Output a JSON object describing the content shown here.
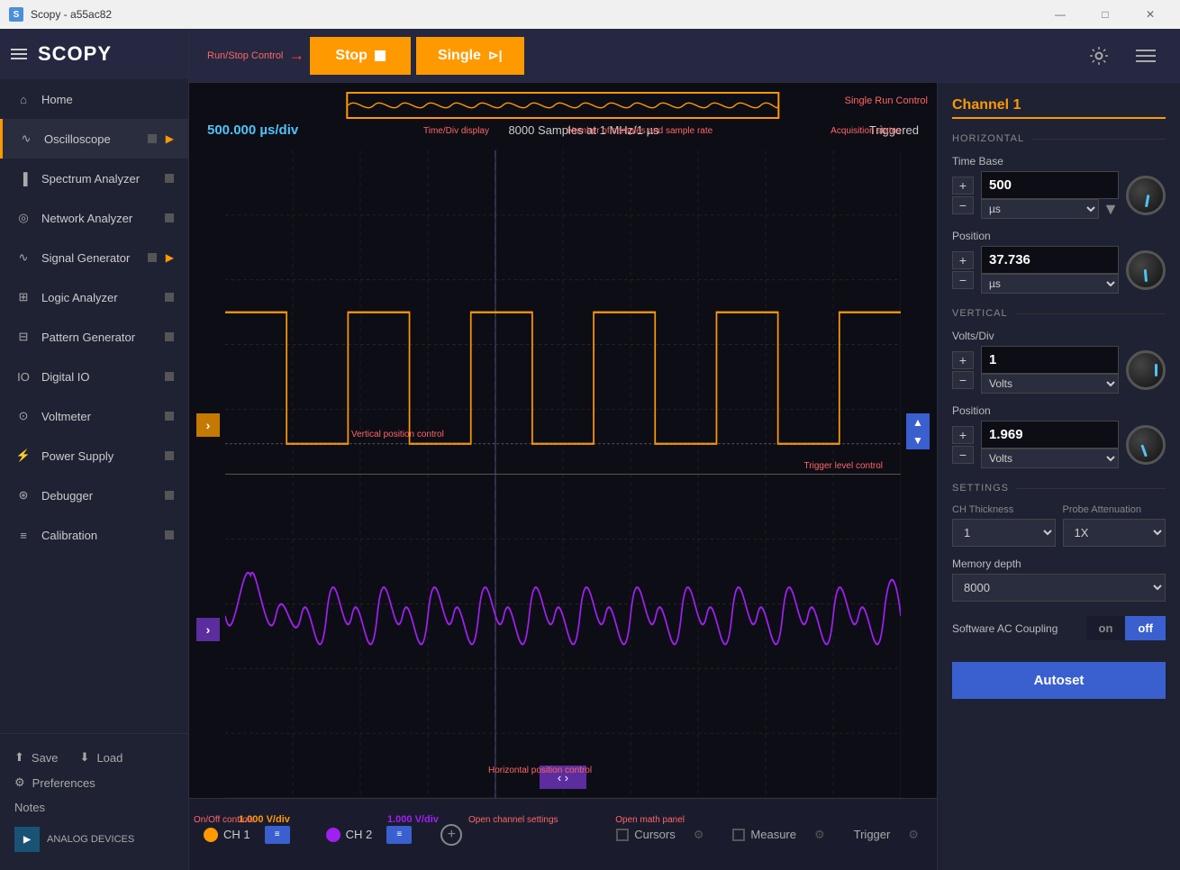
{
  "titlebar": {
    "icon": "S",
    "title": "Scopy - a55ac82",
    "min_btn": "—",
    "max_btn": "□",
    "close_btn": "✕"
  },
  "app_title": "SCOPY",
  "toolbar": {
    "run_stop_label": "Run/Stop Control",
    "stop_btn": "Stop",
    "single_btn": "Single",
    "single_run_label": "Single Run Control"
  },
  "sidebar": {
    "items": [
      {
        "id": "home",
        "label": "Home",
        "icon": "home",
        "active": false,
        "has_indicator": false,
        "has_arrow": false
      },
      {
        "id": "oscilloscope",
        "label": "Oscilloscope",
        "icon": "osc",
        "active": true,
        "has_indicator": true,
        "has_arrow": true
      },
      {
        "id": "spectrum",
        "label": "Spectrum Analyzer",
        "icon": "spectrum",
        "active": false,
        "has_indicator": true,
        "has_arrow": false
      },
      {
        "id": "network",
        "label": "Network Analyzer",
        "icon": "network",
        "active": false,
        "has_indicator": true,
        "has_arrow": false
      },
      {
        "id": "signal",
        "label": "Signal Generator",
        "icon": "signal",
        "active": false,
        "has_indicator": true,
        "has_arrow": true
      },
      {
        "id": "logic",
        "label": "Logic Analyzer",
        "icon": "logic",
        "active": false,
        "has_indicator": true,
        "has_arrow": false
      },
      {
        "id": "pattern",
        "label": "Pattern Generator",
        "icon": "pattern",
        "active": false,
        "has_indicator": true,
        "has_arrow": false
      },
      {
        "id": "digital",
        "label": "Digital IO",
        "icon": "digital",
        "active": false,
        "has_indicator": true,
        "has_arrow": false
      },
      {
        "id": "voltmeter",
        "label": "Voltmeter",
        "icon": "voltmeter",
        "active": false,
        "has_indicator": true,
        "has_arrow": false
      },
      {
        "id": "power",
        "label": "Power Supply",
        "icon": "power",
        "active": false,
        "has_indicator": true,
        "has_arrow": false
      },
      {
        "id": "debugger",
        "label": "Debugger",
        "icon": "debug",
        "active": false,
        "has_indicator": true,
        "has_arrow": false
      },
      {
        "id": "calibration",
        "label": "Calibration",
        "icon": "cal",
        "active": false,
        "has_indicator": true,
        "has_arrow": false
      }
    ],
    "footer": {
      "save": "Save",
      "load": "Load",
      "preferences": "Preferences",
      "notes": "Notes",
      "company": "ANALOG DEVICES"
    }
  },
  "scope": {
    "time_div": "500.000 µs/div",
    "samples_info": "8000 Samples at 1 MHz/1 µs",
    "status": "Triggered",
    "ch1_color": "#f90",
    "ch2_color": "#a020f0",
    "ch1_label": "CH 1",
    "ch2_label": "CH 2",
    "ch1_vdiv": "1.000 V/div",
    "ch2_vdiv": "1.000 V/div",
    "annotations": {
      "time_div": "Time/Div display",
      "samples": "Number of samples and sample rate",
      "acq_status": "Acquisition status",
      "v_pos": "Vertical position control",
      "trigger": "Trigger level control",
      "h_pos": "Horizontal position control",
      "on_off": "On/Off controls",
      "ch_settings": "Open channel settings",
      "math_panel": "Open math panel"
    }
  },
  "right_panel": {
    "channel_title": "Channel 1",
    "horizontal_label": "HORIZONTAL",
    "vertical_label": "VERTICAL",
    "settings_label": "SETTINGS",
    "time_base": {
      "label": "Time Base",
      "value": "500",
      "unit": "µs"
    },
    "h_position": {
      "label": "Position",
      "value": "37.736",
      "unit": "µs"
    },
    "volts_div": {
      "label": "Volts/Div",
      "value": "1",
      "unit": "Volts"
    },
    "v_position": {
      "label": "Position",
      "value": "1.969",
      "unit": "Volts"
    },
    "ch_thickness_label": "CH Thickness",
    "ch_thickness_value": "1",
    "probe_att_label": "Probe Attenuation",
    "probe_att_value": "1X",
    "memory_depth_label": "Memory depth",
    "memory_depth_value": "8000",
    "sw_ac_coupling_label": "Software AC Coupling",
    "toggle_on": "on",
    "toggle_off": "off",
    "autoset_btn": "Autoset"
  },
  "bottom_bar": {
    "cursors_label": "Cursors",
    "measure_label": "Measure",
    "trigger_label": "Trigger"
  }
}
